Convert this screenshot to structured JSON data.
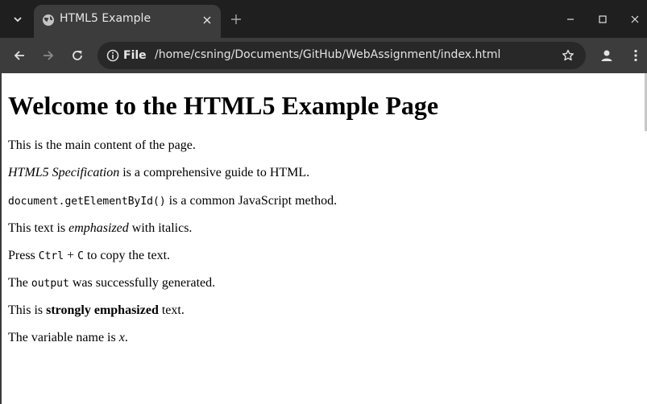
{
  "browser": {
    "tab": {
      "title": "HTML5 Example"
    },
    "address_bar": {
      "scheme_label": "File",
      "url": "/home/csning/Documents/GitHub/WebAssignment/index.html"
    },
    "colors": {
      "tabstrip_bg": "#1f1f1f",
      "toolbar_bg": "#3c3c3c",
      "omnibox_bg": "#282828",
      "icon": "#e3e3e3"
    },
    "icons": [
      "tab-search-icon",
      "globe-icon",
      "close-icon",
      "plus-icon",
      "minimize-icon",
      "maximize-icon",
      "window-close-icon",
      "back-arrow-icon",
      "forward-arrow-icon",
      "reload-icon",
      "info-icon",
      "star-icon",
      "profile-icon",
      "kebab-menu-icon"
    ]
  },
  "page": {
    "heading": "Welcome to the HTML5 Example Page",
    "p1": "This is the main content of the page.",
    "p2": {
      "cite": "HTML5 Specification",
      "rest": " is a comprehensive guide to HTML."
    },
    "p3": {
      "code": "document.getElementById()",
      "rest": " is a common JavaScript method."
    },
    "p4": {
      "pre": "This text is ",
      "em": "emphasized",
      "post": " with italics."
    },
    "p5": {
      "pre": "Press ",
      "kbd1": "Ctrl",
      "plus": " + ",
      "kbd2": "C",
      "post": " to copy the text."
    },
    "p6": {
      "pre": "The ",
      "samp": "output",
      "post": " was successfully generated."
    },
    "p7": {
      "pre": "This is ",
      "strong": "strongly emphasized",
      "post": " text."
    },
    "p8": {
      "pre": "The variable name is ",
      "var": "x",
      "post": "."
    }
  }
}
